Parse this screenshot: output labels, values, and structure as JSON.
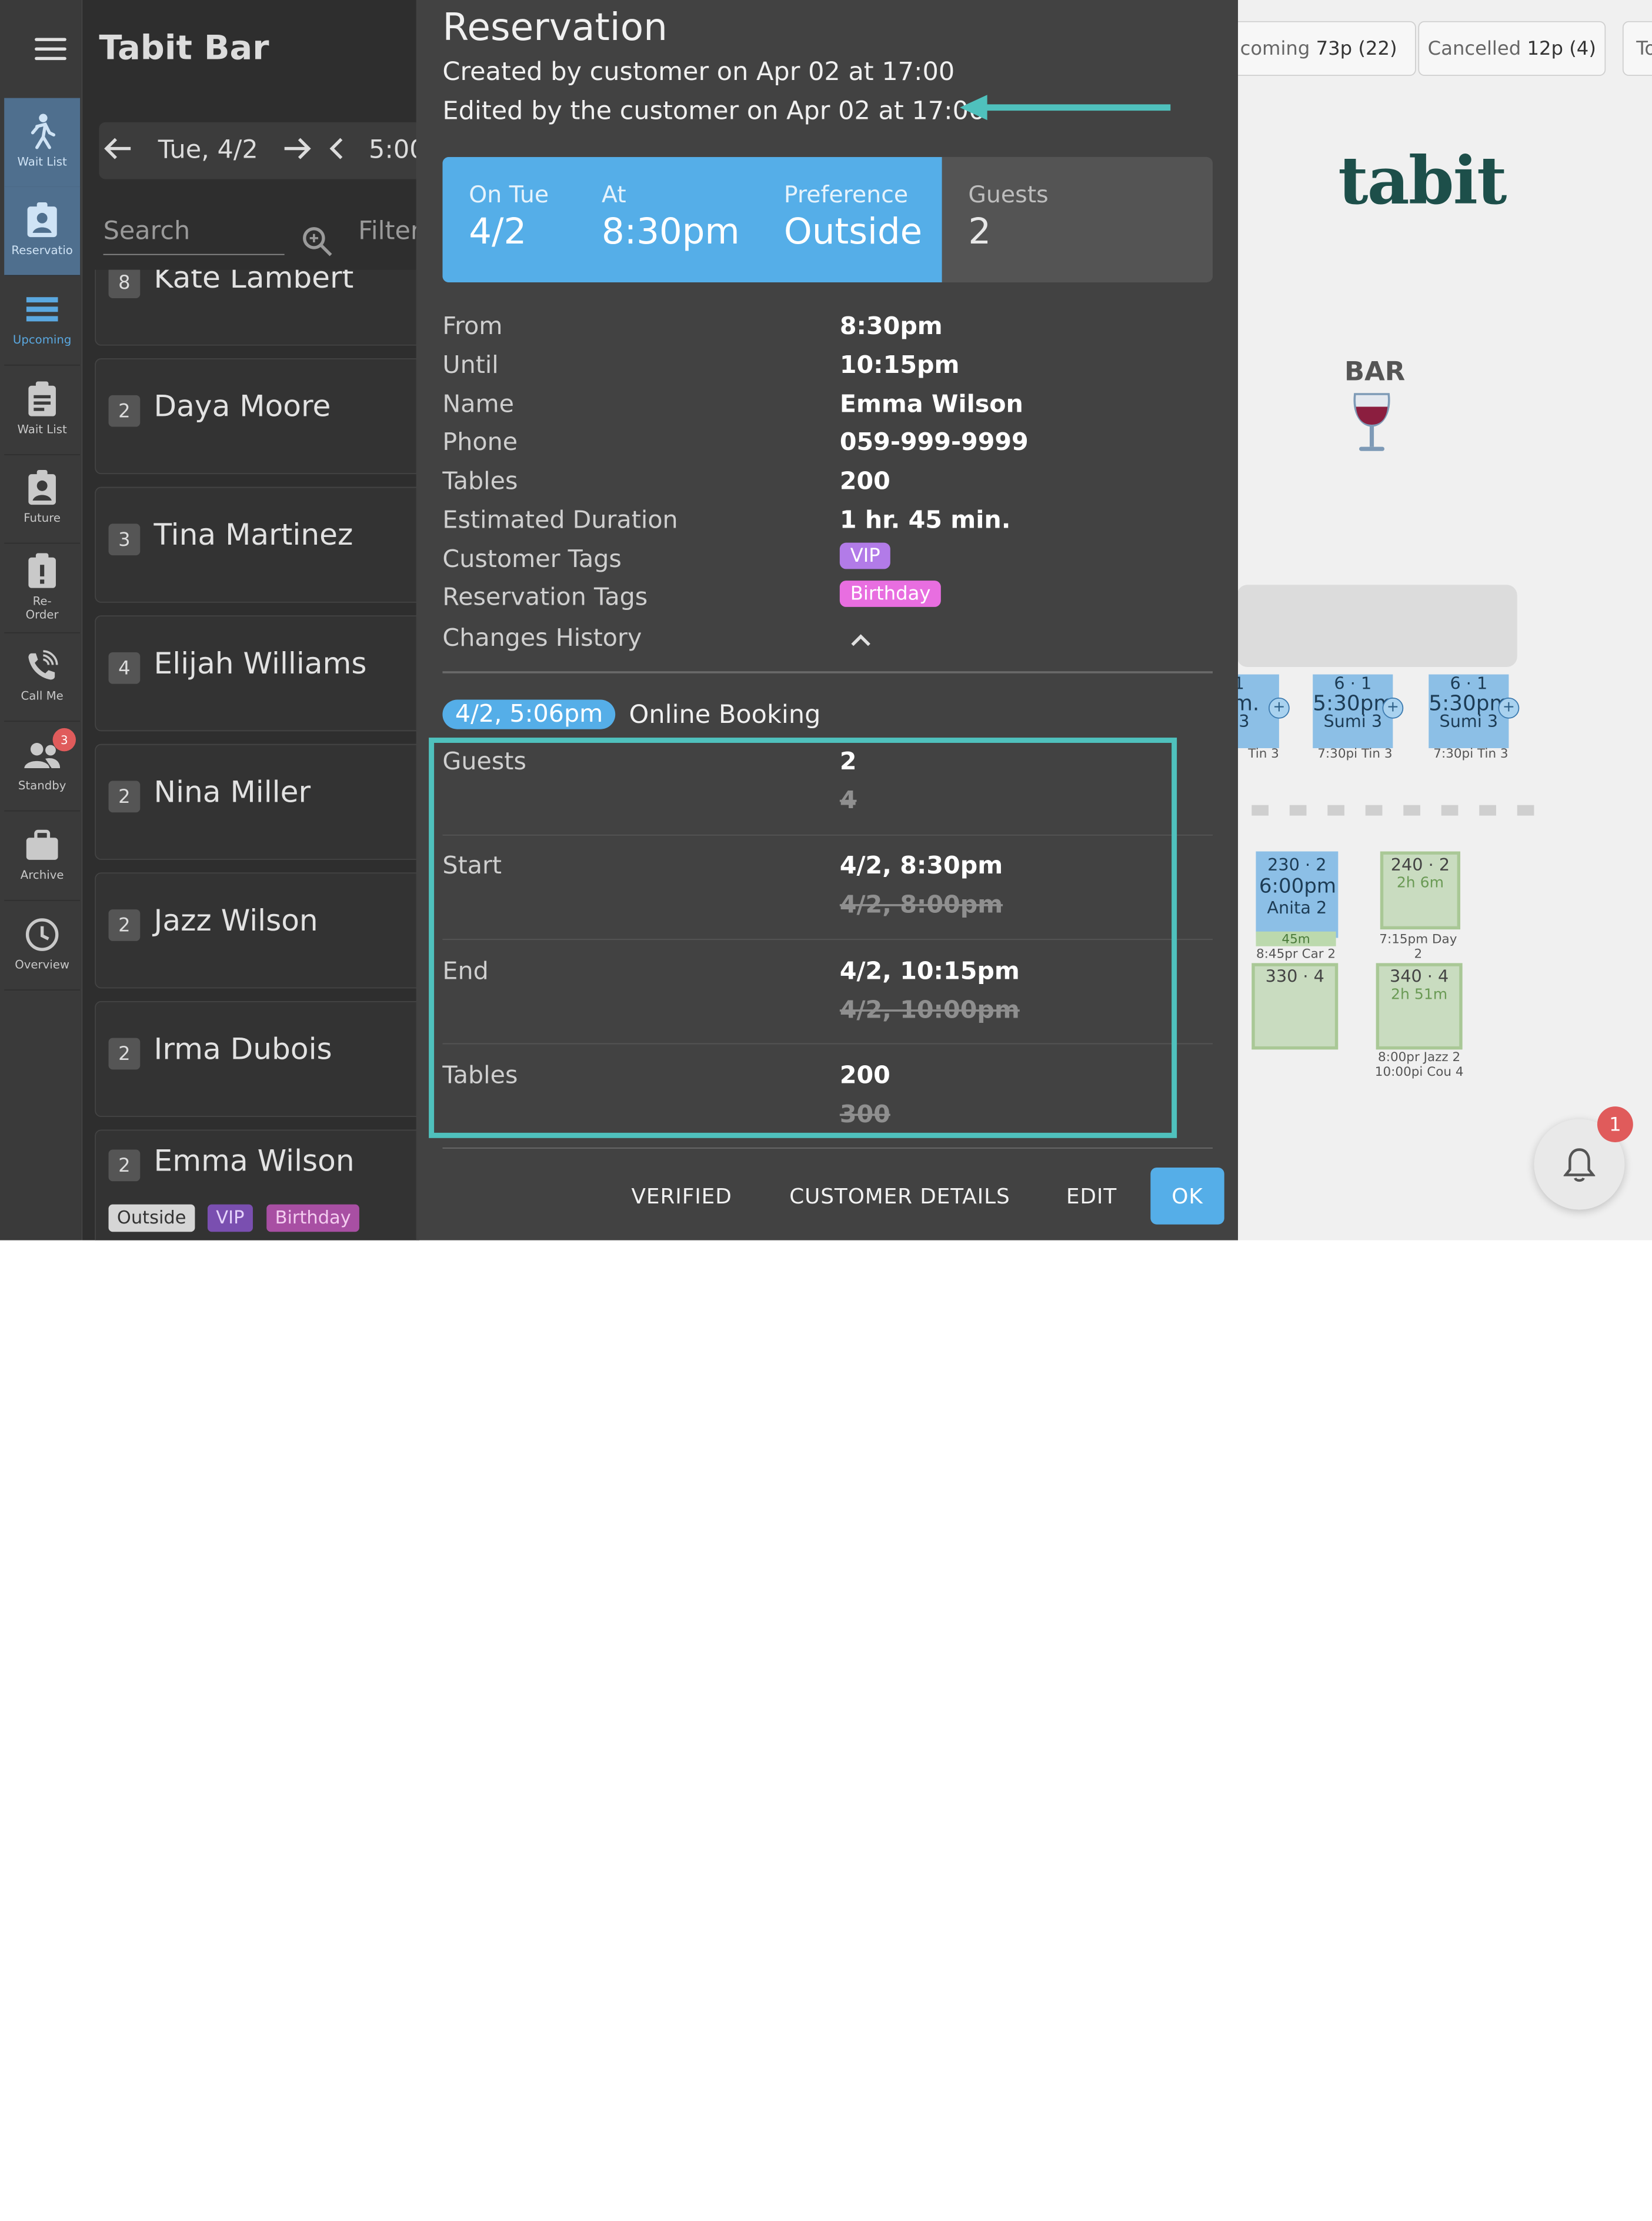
{
  "app": {
    "title": "Tabit Bar",
    "brand": "tabit"
  },
  "sidebar": {
    "items": [
      {
        "label": "Wait List"
      },
      {
        "label": "Reservatio"
      },
      {
        "label": "Upcoming"
      },
      {
        "label": "Wait List"
      },
      {
        "label": "Future"
      },
      {
        "label": "Re-\nOrder"
      },
      {
        "label": "Call Me"
      },
      {
        "label": "Standby",
        "badge": "3"
      },
      {
        "label": "Archive"
      },
      {
        "label": "Overview"
      }
    ]
  },
  "datebar": {
    "date": "Tue, 4/2",
    "time": "5:00"
  },
  "search": {
    "placeholder": "Search",
    "filter": "Filter"
  },
  "list": [
    {
      "count": "8",
      "name": "Kate Lambert"
    },
    {
      "count": "2",
      "name": "Daya Moore"
    },
    {
      "count": "3",
      "name": "Tina Martinez"
    },
    {
      "count": "4",
      "name": "Elijah Williams"
    },
    {
      "count": "2",
      "name": "Nina Miller"
    },
    {
      "count": "2",
      "name": "Jazz Wilson"
    },
    {
      "count": "2",
      "name": "Irma Dubois"
    },
    {
      "count": "2",
      "name": "Emma Wilson",
      "tags": [
        "Outside",
        "VIP",
        "Birthday"
      ]
    }
  ],
  "tabs": {
    "upcoming": {
      "label": "coming",
      "value": "73p (22)"
    },
    "cancelled": {
      "label": "Cancelled",
      "value": "12p (4)"
    },
    "more": "To"
  },
  "floor": {
    "bar_label": "BAR",
    "seats": [
      {
        "top": "1",
        "time": "pm.",
        "name": "i 3",
        "foot": "Tin 3"
      },
      {
        "top": "6 · 1",
        "time": "5:30pm.",
        "name": "Sumi 3",
        "foot": "7:30pi Tin 3"
      },
      {
        "top": "6 · 1",
        "time": "5:30pm.",
        "name": "Sumi 3",
        "foot": "7:30pi Tin 3"
      }
    ],
    "tables": {
      "t230": {
        "head": "230 · 2",
        "time": "6:00pm",
        "name": "Anita 2",
        "dur": "45m",
        "foot": "8:45pr Car 2"
      },
      "t240": {
        "head": "240 · 2",
        "dur": "2h 6m",
        "foot": "7:15pm Day 2"
      },
      "t330": {
        "head": "330 · 4"
      },
      "t340": {
        "head": "340 · 4",
        "dur": "2h 51m",
        "foot1": "8:00pr Jazz 2",
        "foot2": "10:00pi Cou 4"
      }
    },
    "notifications": "1"
  },
  "modal": {
    "title": "Reservation",
    "created": "Created by customer on Apr 02 at 17:00",
    "edited": "Edited by the customer on Apr 02 at 17:06",
    "summary": {
      "on_label": "On Tue",
      "on_value": "4/2",
      "at_label": "At",
      "at_value": "8:30pm",
      "pref_label": "Preference",
      "pref_value": "Outside",
      "guests_label": "Guests",
      "guests_value": "2"
    },
    "details": [
      {
        "k": "From",
        "v": "8:30pm"
      },
      {
        "k": "Until",
        "v": "10:15pm"
      },
      {
        "k": "Name",
        "v": "Emma Wilson"
      },
      {
        "k": "Phone",
        "v": "059-999-9999"
      },
      {
        "k": "Tables",
        "v": "200"
      },
      {
        "k": "Estimated Duration",
        "v": "1 hr. 45 min."
      }
    ],
    "customer_tags_label": "Customer Tags",
    "customer_tag": "VIP",
    "reservation_tags_label": "Reservation Tags",
    "reservation_tag": "Birthday",
    "changes_label": "Changes History",
    "history": {
      "date": "4/2, 5:06pm",
      "source": "Online Booking",
      "changes": [
        {
          "k": "Guests",
          "new": "2",
          "old": "4"
        },
        {
          "k": "Start",
          "new": "4/2, 8:30pm",
          "old": "4/2, 8:00pm"
        },
        {
          "k": "End",
          "new": "4/2, 10:15pm",
          "old": "4/2, 10:00pm"
        },
        {
          "k": "Tables",
          "new": "200",
          "old": "300"
        }
      ]
    },
    "buttons": {
      "verified": "VERIFIED",
      "customer_details": "CUSTOMER DETAILS",
      "edit": "EDIT",
      "ok": "OK"
    }
  },
  "colors": {
    "accent": "#55aee8",
    "highlight": "#4fc1bd",
    "vip": "#b27be8",
    "birthday": "#e86ee0"
  }
}
